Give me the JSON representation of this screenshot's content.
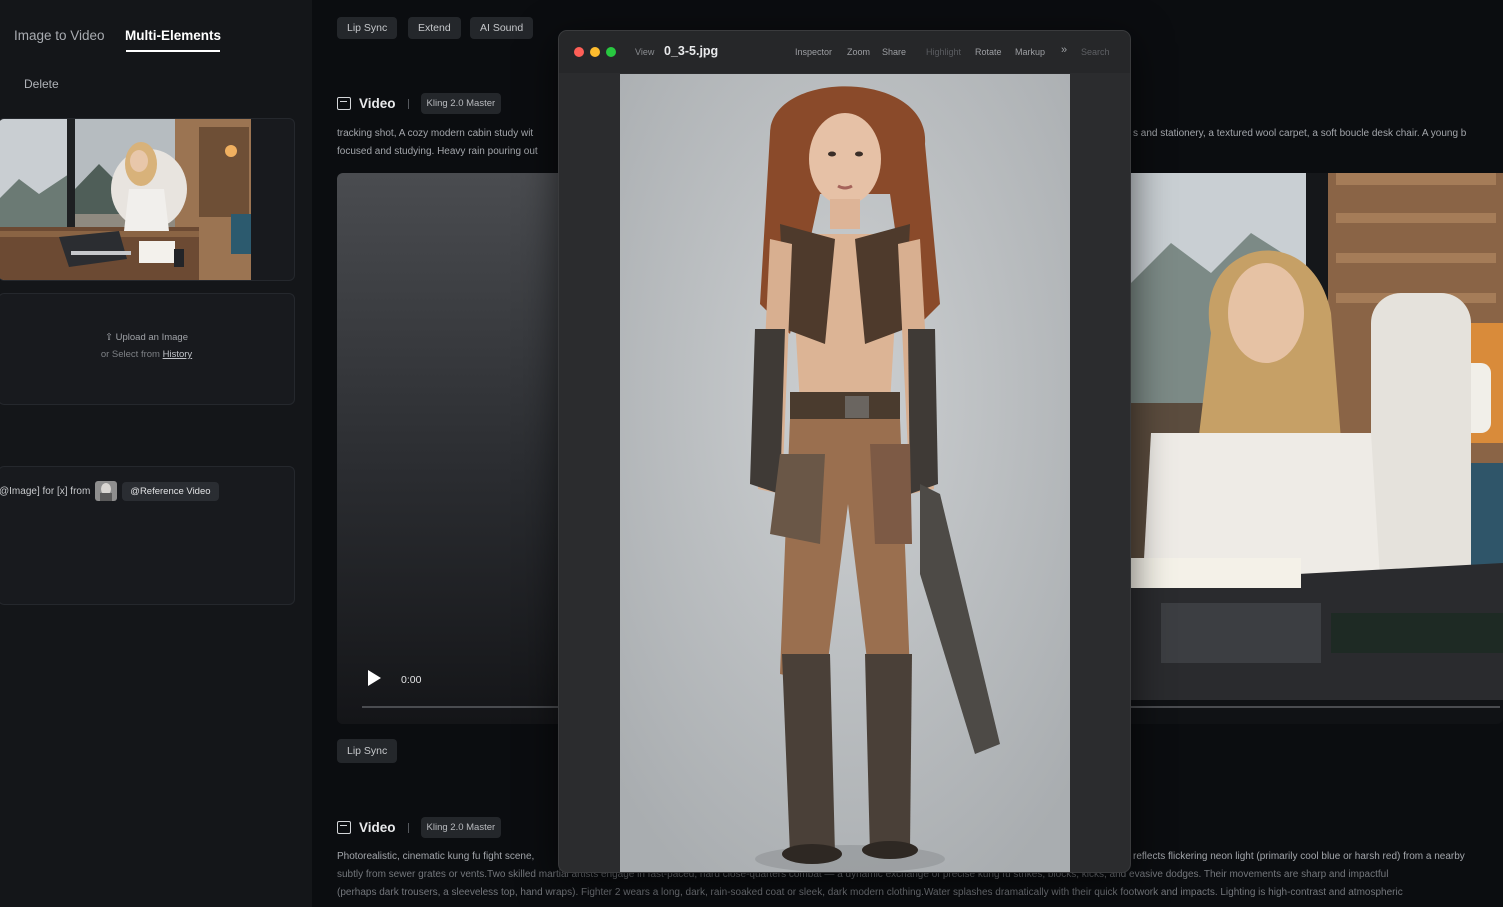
{
  "left_panel": {
    "tabs": [
      {
        "label": "Image to Video"
      },
      {
        "label": "Multi-Elements"
      }
    ],
    "delete_label": "Delete",
    "upload": {
      "line1": "Upload an Image",
      "line2_prefix": "or Select from",
      "history_link": "History"
    },
    "prompt": {
      "prefix": "@Image] for [x] from",
      "reference_chip": "@Reference Video"
    }
  },
  "main": {
    "top_chips": [
      "Lip Sync",
      "Extend",
      "AI Sound"
    ],
    "section1": {
      "label": "Video",
      "model": "Kling 2.0 Master",
      "desc_line1_left": "tracking shot, A cozy modern cabin study wit",
      "desc_line2_left": "focused and studying. Heavy rain pouring out",
      "desc_line1_right": "s and stationery, a textured wool carpet, a soft boucle desk chair. A young b"
    },
    "player": {
      "time": "0:00"
    },
    "lip_sync_label": "Lip Sync",
    "section2": {
      "label": "Video",
      "model": "Kling 2.0 Master",
      "desc_line1_left": "Photorealistic, cinematic kung fu fight scene,",
      "desc_line1_right": "reflects flickering neon light (primarily cool blue or harsh red) from a nearby",
      "desc_line2": "subtly from sewer grates or vents.Two skilled martial artists engage in fast-paced, hard close-quarters combat — a dynamic exchange of precise kung fu strikes, blocks, kicks, and evasive dodges. Their movements are sharp and impactful",
      "desc_line3": "(perhaps dark trousers, a sleeveless top, hand wraps). Fighter 2 wears a long, dark, rain-soaked coat or sleek, dark modern clothing.Water splashes dramatically with their quick footwork and impacts. Lighting is high-contrast and atmospheric"
    }
  },
  "quicklook": {
    "view_label": "View",
    "filename": "0_3-5.jpg",
    "tools": [
      "Inspector",
      "Zoom",
      "Share",
      "Highlight",
      "Rotate",
      "Markup"
    ],
    "search_placeholder": "Search",
    "colors": {
      "close": "#fe5f57",
      "minimize": "#febc2e",
      "zoom": "#28c840"
    }
  }
}
